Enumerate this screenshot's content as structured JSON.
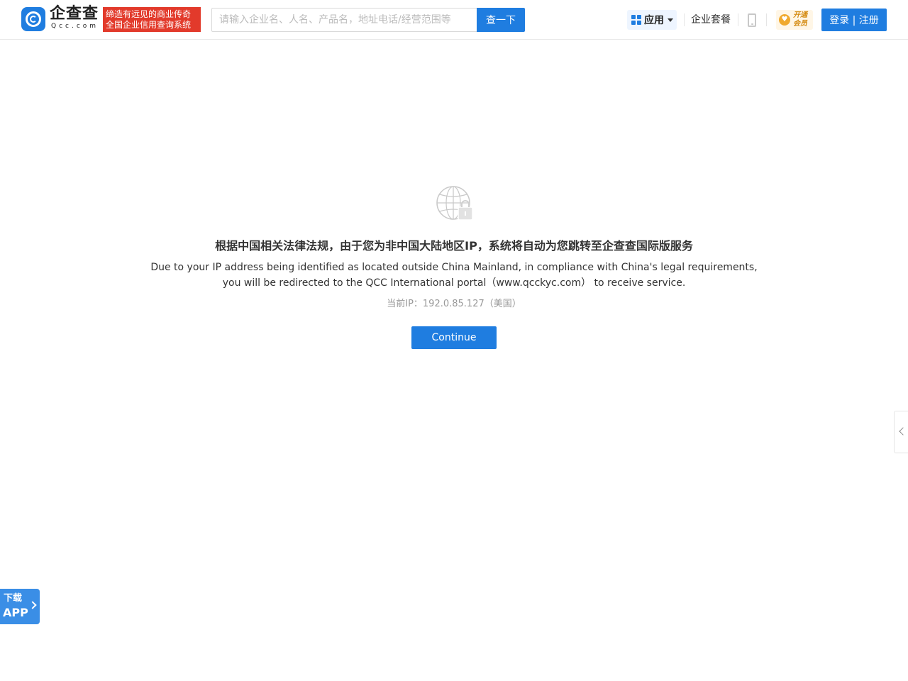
{
  "header": {
    "logo_name": "企查查",
    "logo_domain": "Qcc.com",
    "slogan_line1": "缔造有远见的商业传奇",
    "slogan_line2": "全国企业信用查询系统",
    "search_placeholder": "请输入企业名、人名、产品名，地址电话/经营范围等",
    "search_button": "查一下",
    "apps_label": "应用",
    "package_link": "企业套餐",
    "vip_line1": "开通",
    "vip_line2": "会员",
    "login_label": "登录 | 注册"
  },
  "notice": {
    "title": "根据中国相关法律法规，由于您为非中国大陆地区IP，系统将自动为您跳转至企查查国际版服务",
    "en_line1": "Due to your IP address being identified as located outside China Mainland, in compliance with China's legal requirements,",
    "en_line2": "you will be redirected to the QCC International portal（www.qcckyc.com） to receive service.",
    "ip_text": "当前IP：192.0.85.127（美国）",
    "continue_label": "Continue"
  },
  "app_download": {
    "line1": "下载",
    "line2": "APP"
  },
  "colors": {
    "brand_blue": "#1f7de0",
    "slogan_red": "#e23a2b",
    "vip_gold": "#f0a92e"
  }
}
